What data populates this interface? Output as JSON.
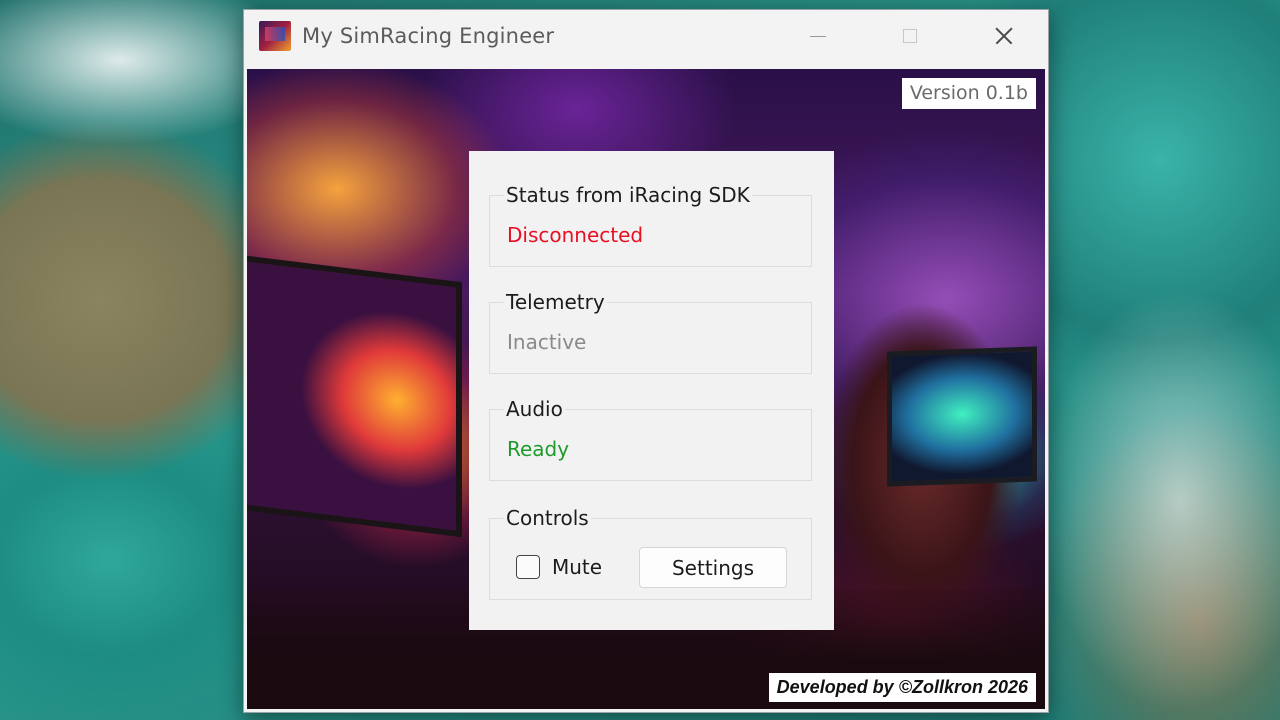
{
  "window": {
    "title": "My SimRacing Engineer"
  },
  "version_label": "Version 0.1b",
  "developer_label": "Developed by ©Zollkron 2026",
  "groups": {
    "status": {
      "title": "Status from iRacing SDK",
      "value": "Disconnected",
      "color": "#e81123"
    },
    "telemetry": {
      "title": "Telemetry",
      "value": "Inactive",
      "color": "#8a8a8a"
    },
    "audio": {
      "title": "Audio",
      "value": "Ready",
      "color": "#1f9a2c"
    },
    "controls": {
      "title": "Controls",
      "mute_label": "Mute",
      "mute_checked": false,
      "settings_label": "Settings"
    }
  }
}
